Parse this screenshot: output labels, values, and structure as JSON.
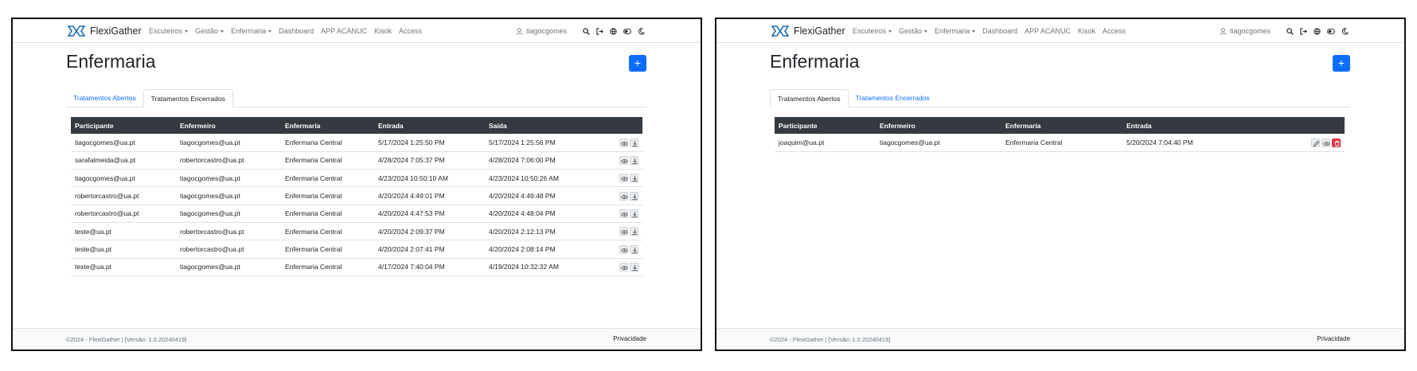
{
  "colors": {
    "primary": "#0d6efd",
    "danger": "#dc3545",
    "table_header": "#343a40",
    "muted": "#6c757d"
  },
  "navbar": {
    "brand": "FlexiGather",
    "links": [
      "Escuteiros",
      "Gestão",
      "Enfermaria",
      "Dashboard",
      "APP ACANUC",
      "Kisok",
      "Access"
    ],
    "user": "tiagocgomes",
    "icons": [
      "user-icon",
      "search-icon",
      "logout-icon",
      "language-icon",
      "contrast-icon",
      "moon-icon"
    ]
  },
  "page": {
    "title": "Enfermaria",
    "add_label": "+"
  },
  "tabs": [
    "Tratamentos Abertos",
    "Tratamentos Encerrados"
  ],
  "closed_table": {
    "headers": [
      "Participante",
      "Enfermeiro",
      "Enfermaria",
      "Entrada",
      "Saída",
      ""
    ],
    "rows": [
      [
        "tiagocgomes@ua.pt",
        "tiagocgomes@ua.pt",
        "Enfermaria Central",
        "5/17/2024 1:25:50 PM",
        "5/17/2024 1:25:56 PM"
      ],
      [
        "sarafalmeida@ua.pt",
        "robertorcastro@ua.pt",
        "Enfermaria Central",
        "4/28/2024 7:05:37 PM",
        "4/28/2024 7:06:00 PM"
      ],
      [
        "tiagocgomes@ua.pt",
        "tiagocgomes@ua.pt",
        "Enfermaria Central",
        "4/23/2024 10:50:10 AM",
        "4/23/2024 10:50:26 AM"
      ],
      [
        "robertorcastro@ua.pt",
        "tiagocgomes@ua.pt",
        "Enfermaria Central",
        "4/20/2024 4:49:01 PM",
        "4/20/2024 4:49:48 PM"
      ],
      [
        "robertorcastro@ua.pt",
        "tiagocgomes@ua.pt",
        "Enfermaria Central",
        "4/20/2024 4:47:53 PM",
        "4/20/2024 4:48:04 PM"
      ],
      [
        "teste@ua.pt",
        "robertorcastro@ua.pt",
        "Enfermaria Central",
        "4/20/2024 2:09:37 PM",
        "4/20/2024 2:12:13 PM"
      ],
      [
        "teste@ua.pt",
        "robertorcastro@ua.pt",
        "Enfermaria Central",
        "4/20/2024 2:07:41 PM",
        "4/20/2024 2:08:14 PM"
      ],
      [
        "teste@ua.pt",
        "tiagocgomes@ua.pt",
        "Enfermaria Central",
        "4/17/2024 7:40:04 PM",
        "4/19/2024 10:32:32 AM"
      ]
    ]
  },
  "open_table": {
    "headers": [
      "Participante",
      "Enfermeiro",
      "Enfermaria",
      "Entrada",
      ""
    ],
    "rows": [
      [
        "joaquim@ua.pt",
        "tiagocgomes@ua.pt",
        "Enfermaria Central",
        "5/20/2024 7:04:40 PM"
      ]
    ]
  },
  "footer": {
    "text": "©2024 - FlexiGather | [Versão: 1.0.20240419]",
    "privacy": "Privacidade"
  }
}
